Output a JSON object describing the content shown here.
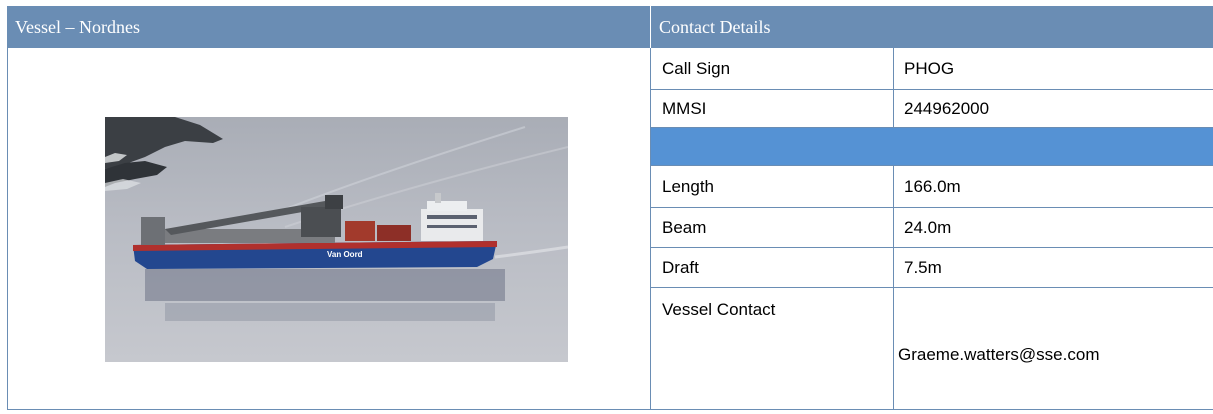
{
  "headers": {
    "vessel": "Vessel – Nordnes",
    "contact": "Contact Details"
  },
  "photo": {
    "alt": "Van Oord fall-pipe vessel on calm water",
    "hull_text": "Van Oord"
  },
  "details": {
    "call_sign": {
      "label": "Call Sign",
      "value": "PHOG"
    },
    "mmsi": {
      "label": "MMSI",
      "value": "244962000"
    },
    "length": {
      "label": "Length",
      "value": "166.0m"
    },
    "beam": {
      "label": "Beam",
      "value": "24.0m"
    },
    "draft": {
      "label": "Draft",
      "value": "7.5m"
    },
    "vessel_contact": {
      "label": "Vessel Contact",
      "value": "Graeme.watters@sse.com"
    }
  },
  "colors": {
    "header_bg": "#6a8db4",
    "band_bg": "#5592d4",
    "hull_blue": "#23478f",
    "hull_red": "#b0302d"
  }
}
